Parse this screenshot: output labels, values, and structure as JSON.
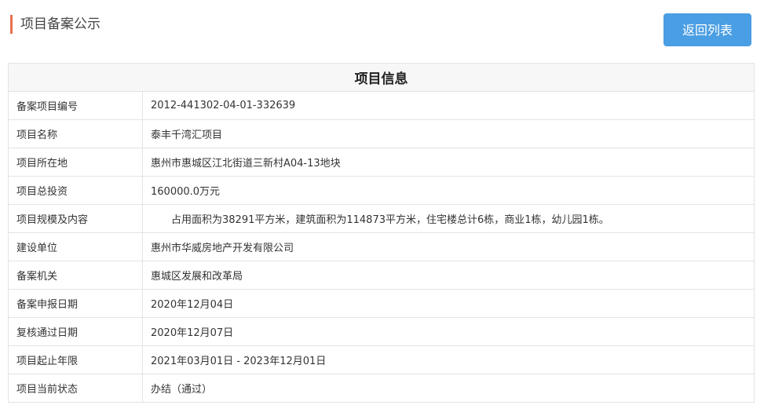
{
  "header": {
    "title": "项目备案公示",
    "back_label": "返回列表"
  },
  "table": {
    "title": "项目信息",
    "rows": [
      {
        "label": "备案项目编号",
        "value": "2012-441302-04-01-332639"
      },
      {
        "label": "项目名称",
        "value": "泰丰千湾汇项目"
      },
      {
        "label": "项目所在地",
        "value": "惠州市惠城区江北街道三新村A04-13地块"
      },
      {
        "label": "项目总投资",
        "value": "160000.0万元"
      },
      {
        "label": "项目规模及内容",
        "value": "　　占用面积为38291平方米，建筑面积为114873平方米，住宅楼总计6栋，商业1栋，幼儿园1栋。"
      },
      {
        "label": "建设单位",
        "value": "惠州市华威房地产开发有限公司"
      },
      {
        "label": "备案机关",
        "value": "惠城区发展和改革局"
      },
      {
        "label": "备案申报日期",
        "value": "2020年12月04日"
      },
      {
        "label": "复核通过日期",
        "value": "2020年12月07日"
      },
      {
        "label": "项目起止年限",
        "value": "2021年03月01日 - 2023年12月01日"
      },
      {
        "label": "项目当前状态",
        "value": "办结（通过）"
      }
    ]
  }
}
